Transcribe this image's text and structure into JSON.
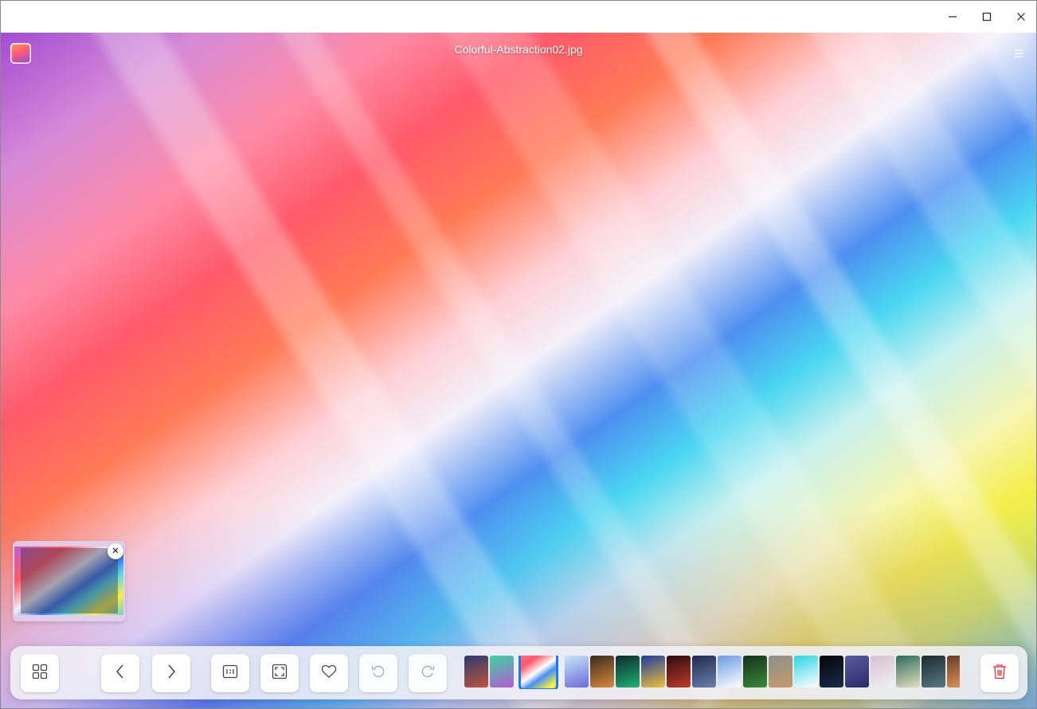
{
  "window": {
    "controls": {
      "minimize_icon": "minimize-icon",
      "maximize_icon": "maximize-icon",
      "close_icon": "close-icon"
    }
  },
  "viewer": {
    "title": "Colorful-Abstraction02.jpg",
    "app_logo_icon": "app-logo-icon",
    "menu_icon": "hamburger-menu-icon"
  },
  "navigator": {
    "close_icon": "close-icon"
  },
  "toolbar": {
    "buttons": [
      {
        "name": "thumbnail-view-button",
        "icon": "grid-icon"
      },
      {
        "name": "previous-button",
        "icon": "chevron-left-icon"
      },
      {
        "name": "next-button",
        "icon": "chevron-right-icon"
      },
      {
        "name": "original-size-button",
        "icon": "actual-size-1-1-icon"
      },
      {
        "name": "fit-window-button",
        "icon": "fit-to-window-icon"
      },
      {
        "name": "favorite-button",
        "icon": "heart-icon"
      },
      {
        "name": "rotate-left-button",
        "icon": "rotate-counterclockwise-icon"
      },
      {
        "name": "rotate-right-button",
        "icon": "rotate-clockwise-icon"
      },
      {
        "name": "delete-button",
        "icon": "trash-icon"
      }
    ],
    "thumbnails": [
      {
        "colors": [
          "#2a3a6e",
          "#c2553a"
        ]
      },
      {
        "colors": [
          "#3ad6a0",
          "#b55ad6"
        ]
      },
      {
        "colors": [
          "#ff6e9a",
          "#4a8ff0"
        ],
        "current": true
      },
      {
        "colors": [
          "#c8e6f5",
          "#6a6ae0"
        ]
      },
      {
        "colors": [
          "#3a2a1e",
          "#d98a3a"
        ]
      },
      {
        "colors": [
          "#0b2a2a",
          "#23b07a"
        ]
      },
      {
        "colors": [
          "#1a3aa0",
          "#f0c23a"
        ]
      },
      {
        "colors": [
          "#2a0c10",
          "#c23a2a"
        ]
      },
      {
        "colors": [
          "#1e2a4a",
          "#6a80b0"
        ]
      },
      {
        "colors": [
          "#6a9ae6",
          "#ffffff"
        ]
      },
      {
        "colors": [
          "#12301a",
          "#3a8a3a"
        ]
      },
      {
        "colors": [
          "#8a9090",
          "#c89a6a"
        ]
      },
      {
        "colors": [
          "#2ad6e6",
          "#ffffff"
        ]
      },
      {
        "colors": [
          "#05050a",
          "#1a2a4a"
        ]
      },
      {
        "colors": [
          "#5a5aa0",
          "#2a2a6a"
        ]
      },
      {
        "colors": [
          "#d8c0d0",
          "#f0f0f6"
        ]
      },
      {
        "colors": [
          "#2a6a5a",
          "#e6e0c0"
        ]
      },
      {
        "colors": [
          "#1a2a30",
          "#5a7a80"
        ]
      },
      {
        "colors": [
          "#6a3a2a",
          "#e69a5a"
        ]
      }
    ]
  }
}
